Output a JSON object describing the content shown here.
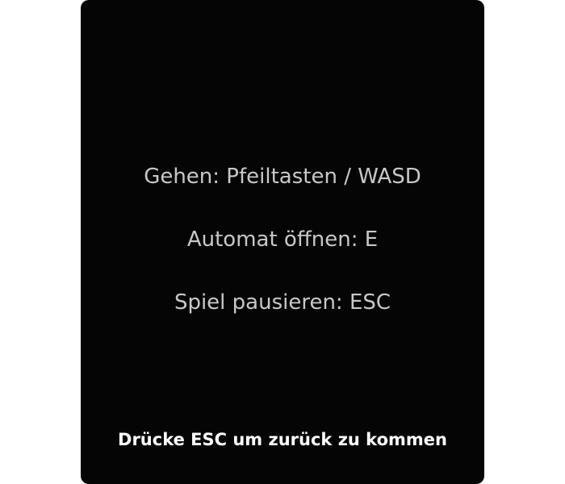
{
  "controls_menu": {
    "lines": [
      "Gehen: Pfeiltasten / WASD",
      "Automat öffnen: E",
      "Spiel pausieren: ESC"
    ],
    "back_hint": "Drücke ESC um zurück zu kommen"
  },
  "colors": {
    "panel_background": "#050505",
    "control_text": "#c8c8c8",
    "hint_text": "#ffffff",
    "page_background": "#ffffff"
  }
}
